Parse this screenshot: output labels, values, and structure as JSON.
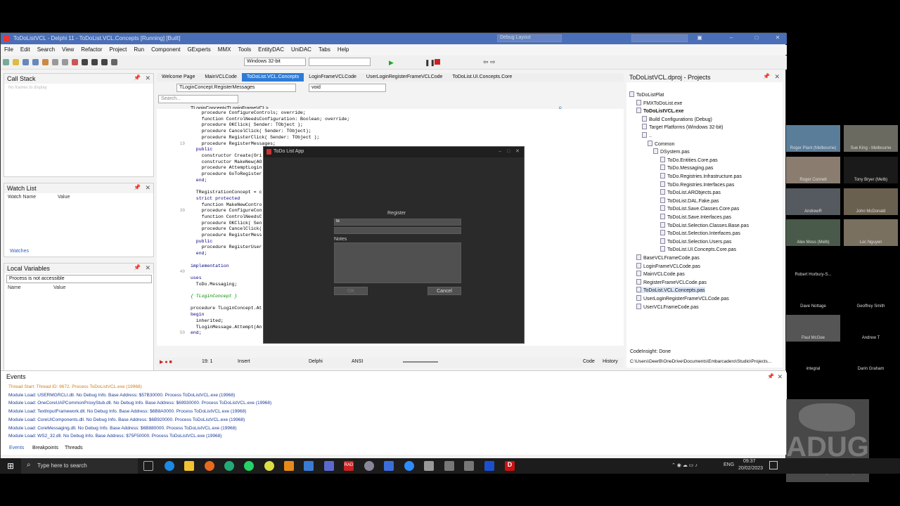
{
  "ide": {
    "title": "ToDoListVCL - Delphi 11 - ToDoList.VCL.Concepts [Running] [Built]",
    "config": "Debug Layout",
    "menu": [
      "File",
      "Edit",
      "Search",
      "View",
      "Refactor",
      "Project",
      "Run",
      "Component",
      "GExperts",
      "MMX",
      "Tools",
      "EntityDAC",
      "UniDAC",
      "Tabs",
      "Help"
    ],
    "platform": "Windows 32-bit"
  },
  "left": {
    "callstack_title": "Call Stack",
    "callstack_hint": "No frames to display",
    "watch_title": "Watch List",
    "watch_cols": [
      "Watch Name",
      "Value"
    ],
    "watches_tab": "Watches",
    "locals_title": "Local Variables",
    "locals_combo": "Process is not accessible",
    "locals_cols": [
      "Name",
      "Value"
    ]
  },
  "editor": {
    "tabs": [
      "Welcome Page",
      "MainVCLCode",
      "ToDoList.VCL.Concepts",
      "LoginFrameVCLCode",
      "UserLoginRegisterFrameVCLCode",
      "ToDoList.UI.Concepts.Core"
    ],
    "class_combo": "TLoginConcept.RegisterMessages",
    "method_combo": "void",
    "search_placeholder": "Search...",
    "breadcrumb": "TLoginConcept<TLoginFrameVCL>",
    "lines": [
      {
        "n": "",
        "t": "    procedure ConfigureControls; override;"
      },
      {
        "n": "",
        "t": "    function ControlNeedsConfiguration: Boolean; override;"
      },
      {
        "n": "",
        "t": "    procedure OKClick( Sender: TObject );"
      },
      {
        "n": "",
        "t": "    procedure CancelClick( Sender: TObject);"
      },
      {
        "n": "",
        "t": "    procedure RegisterClick( Sender: TObject );"
      },
      {
        "n": "19",
        "t": "    procedure RegisterMessages;"
      },
      {
        "n": "",
        "t": "  public"
      },
      {
        "n": "",
        "t": "    constructor Create(Ori"
      },
      {
        "n": "",
        "t": "    constructor MakeNew(AO"
      },
      {
        "n": "",
        "t": "    procedure AttemptLogin"
      },
      {
        "n": "",
        "t": "    procedure GoToRegister"
      },
      {
        "n": "",
        "t": "  end;"
      },
      {
        "n": "",
        "t": ""
      },
      {
        "n": "",
        "t": "  TRegistrationConcept = c"
      },
      {
        "n": "",
        "t": "  strict protected"
      },
      {
        "n": "",
        "t": "    function MakeNewContro"
      },
      {
        "n": "30",
        "t": "    procedure ConfigureCon"
      },
      {
        "n": "",
        "t": "    function ControlNeedsC"
      },
      {
        "n": "",
        "t": "    procedure OKClick( Sen"
      },
      {
        "n": "",
        "t": "    procedure CancelClick("
      },
      {
        "n": "",
        "t": "    procedure RegisterMess"
      },
      {
        "n": "",
        "t": "  public"
      },
      {
        "n": "",
        "t": "    procedure RegisterUser"
      },
      {
        "n": "",
        "t": "  end;"
      },
      {
        "n": "",
        "t": ""
      },
      {
        "n": "",
        "t": "implementation"
      },
      {
        "n": "40",
        "t": ""
      },
      {
        "n": "",
        "t": "uses"
      },
      {
        "n": "",
        "t": "  ToDo.Messaging;"
      },
      {
        "n": "",
        "t": ""
      },
      {
        "n": "",
        "t": "{ TLoginConcept }"
      },
      {
        "n": "",
        "t": ""
      },
      {
        "n": "",
        "t": "procedure TLoginConcept.At"
      },
      {
        "n": "",
        "t": "begin"
      },
      {
        "n": "",
        "t": "  inherited;"
      },
      {
        "n": "",
        "t": "  TLoginMessage.Attempt(An"
      },
      {
        "n": "50",
        "t": "end;"
      }
    ],
    "status": {
      "pos": "19: 1",
      "mode": "Insert",
      "lang": "Delphi",
      "enc": "ANSI",
      "code": "Code",
      "history": "History"
    }
  },
  "dialog": {
    "title": "ToDo List App",
    "header": "Register",
    "field1": "te",
    "notes_label": "Notes",
    "ok": "OK",
    "cancel": "Cancel"
  },
  "projects": {
    "title": "ToDoListVCL.dproj - Projects",
    "codeinsight": "CodeInsight: Done",
    "path": "C:\\Users\\DeerB\\OneDrive\\Documents\\Embarcadero\\Studio\\Projects...",
    "tree": [
      "ToDoListPlat",
      "FMXToDoList.exe",
      "ToDoListVCL.exe",
      "Build Configurations (Debug)",
      "Target Platforms (Windows 32-bit)",
      "..",
      "Common",
      "DSystem.pas",
      "ToDo.Entities.Core.pas",
      "ToDo.Messaging.pas",
      "ToDo.Registries.Infrastructure.pas",
      "ToDo.Registries.Interfaces.pas",
      "ToDoList.ARObjects.pas",
      "ToDoList.DAL.Fake.pas",
      "ToDoList.Save.Classes.Core.pas",
      "ToDoList.Save.Interfaces.pas",
      "ToDoList.Selection.Classes.Base.pas",
      "ToDoList.Selection.Interfaces.pas",
      "ToDoList.Selection.Users.pas",
      "ToDoList.UI.Concepts.Core.pas",
      "BaseVCLFrameCode.pas",
      "LoginFrameVCLCode.pas",
      "MainVCLCode.pas",
      "RegisterFrameVCLCode.pas",
      "ToDoList.VCL.Concepts.pas",
      "UserLoginRegisterFrameVCLCode.pas",
      "UserVCLFrameCode.pas"
    ]
  },
  "events": {
    "title": "Events",
    "lines": [
      {
        "t": "Thread Start: Thread ID: 9672. Process ToDoListVCL.exe (19968)",
        "c": "#d08020"
      },
      {
        "t": "Module Load: USERMGRCLI.dll. No Debug Info. Base Address: $57B30000. Process ToDoListVCL.exe (19968)",
        "c": "#1a3a9a"
      },
      {
        "t": "Module Load: OneCoreUAPCommonProxyStub.dll. No Debug Info. Base Address: $69930000. Process ToDoListVCL.exe (19968)",
        "c": "#1a3a9a"
      },
      {
        "t": "Module Load: TextInputFramework.dll. No Debug Info. Base Address: $6B8A0000. Process ToDoListVCL.exe (19968)",
        "c": "#1a3a9a"
      },
      {
        "t": "Module Load: CoreUIComponents.dll. No Debug Info. Base Address: $6B920000. Process ToDoListVCL.exe (19968)",
        "c": "#1a3a9a"
      },
      {
        "t": "Module Load: CoreMessaging.dll. No Debug Info. Base Address: $6B880000. Process ToDoListVCL.exe (19968)",
        "c": "#1a3a9a"
      },
      {
        "t": "Module Load: WS2_32.dll. No Debug Info. Base Address: $75F50000. Process ToDoListVCL.exe (19968)",
        "c": "#1a3a9a"
      }
    ],
    "tabs": [
      "Events",
      "Breakpoints",
      "Threads"
    ]
  },
  "taskbar": {
    "search": "Type here to search",
    "time": "09:37",
    "date": "20/02/2023",
    "lang": "ENG"
  },
  "participants": [
    "Roger Plant (Melbourne)",
    "Sue King - Melbourne",
    "Roger Connell",
    "Tony Bryer (Melb)",
    "AndrewR",
    "John McDonald",
    "Alex Moss (Melb)",
    "Loc Nguyen",
    "Robert Horbury-S...",
    "Vincent Parrett (C...",
    "",
    "Vincent Parrett (Cbr)",
    "Dave Nottage",
    "Geoffrey Smith",
    "Dave Nottage",
    "Geoffrey Smith",
    "Paul McGee",
    "Andrew T",
    "Andrew T",
    "integral",
    "Darin Grenham",
    "integral",
    "Darin Graham"
  ],
  "logo": {
    "text": "ADUG",
    "sub": "Australian Delphi User Group"
  }
}
